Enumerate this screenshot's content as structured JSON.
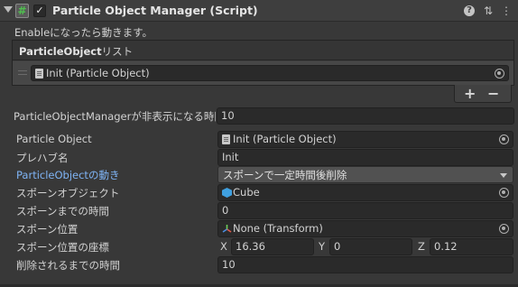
{
  "header": {
    "script_icon": "#",
    "enabled_checkmark": "✓",
    "title": "Particle Object Manager (Script)",
    "help_icon": "?",
    "settings_icon": "⇅",
    "menu_icon": "⋮"
  },
  "description": "Enableになったら動きます。",
  "list": {
    "title_bold": "ParticleObject",
    "title_suffix": "リスト",
    "items": [
      {
        "value": "Init (Particle Object)",
        "icon": "script-asset-icon"
      }
    ],
    "add_label": "+",
    "remove_label": "−"
  },
  "hidden_time": {
    "label": "ParticleObjectManagerが非表示になる時間",
    "value": "10"
  },
  "fields": {
    "particle_object": {
      "label": "Particle Object",
      "value": "Init (Particle Object)",
      "icon": "script-asset-icon"
    },
    "prefab_name": {
      "label": "プレハブ名",
      "value": "Init"
    },
    "movement": {
      "label": "ParticleObjectの動き",
      "value": "スポーンで一定時間後削除"
    },
    "spawn_object": {
      "label": "スポーンオブジェクト",
      "value": "Cube",
      "icon": "cube-icon"
    },
    "spawn_time": {
      "label": "スポーンまでの時間",
      "value": "0"
    },
    "spawn_position": {
      "label": "スポーン位置",
      "value": "None (Transform)",
      "icon": "transform-icon"
    },
    "spawn_coords": {
      "label": "スポーン位置の座標",
      "x_label": "X",
      "x": "16.36",
      "y_label": "Y",
      "y": "0",
      "z_label": "Z",
      "z": "0.12"
    },
    "delete_time": {
      "label": "削除されるまでの時間",
      "value": "10"
    }
  },
  "colors": {
    "background": "#383838",
    "field": "#2a2a2a",
    "highlight_label": "#7fb4f5",
    "script_icon_green": "#4fc14f"
  }
}
